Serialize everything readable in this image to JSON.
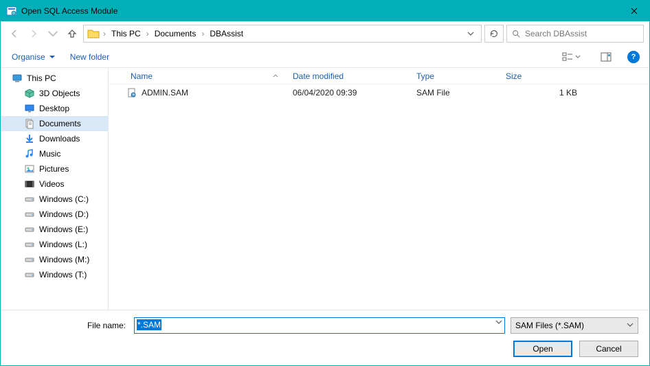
{
  "title": "Open SQL Access Module",
  "breadcrumbs": [
    "This PC",
    "Documents",
    "DBAssist"
  ],
  "search": {
    "placeholder": "Search DBAssist"
  },
  "cmd": {
    "organise": "Organise",
    "newfolder": "New folder"
  },
  "tree": {
    "root": "This PC",
    "items": [
      "3D Objects",
      "Desktop",
      "Documents",
      "Downloads",
      "Music",
      "Pictures",
      "Videos",
      "Windows (C:)",
      "Windows (D:)",
      "Windows (E:)",
      "Windows (L:)",
      "Windows (M:)",
      "Windows (T:)"
    ],
    "selected": 2
  },
  "columns": {
    "name": "Name",
    "date": "Date modified",
    "type": "Type",
    "size": "Size"
  },
  "files": [
    {
      "name": "ADMIN.SAM",
      "date": "06/04/2020 09:39",
      "type": "SAM File",
      "size": "1 KB"
    }
  ],
  "filename": {
    "label": "File name:",
    "value": "*.SAM"
  },
  "filter": {
    "label": "SAM Files (*.SAM)"
  },
  "buttons": {
    "open": "Open",
    "cancel": "Cancel"
  }
}
